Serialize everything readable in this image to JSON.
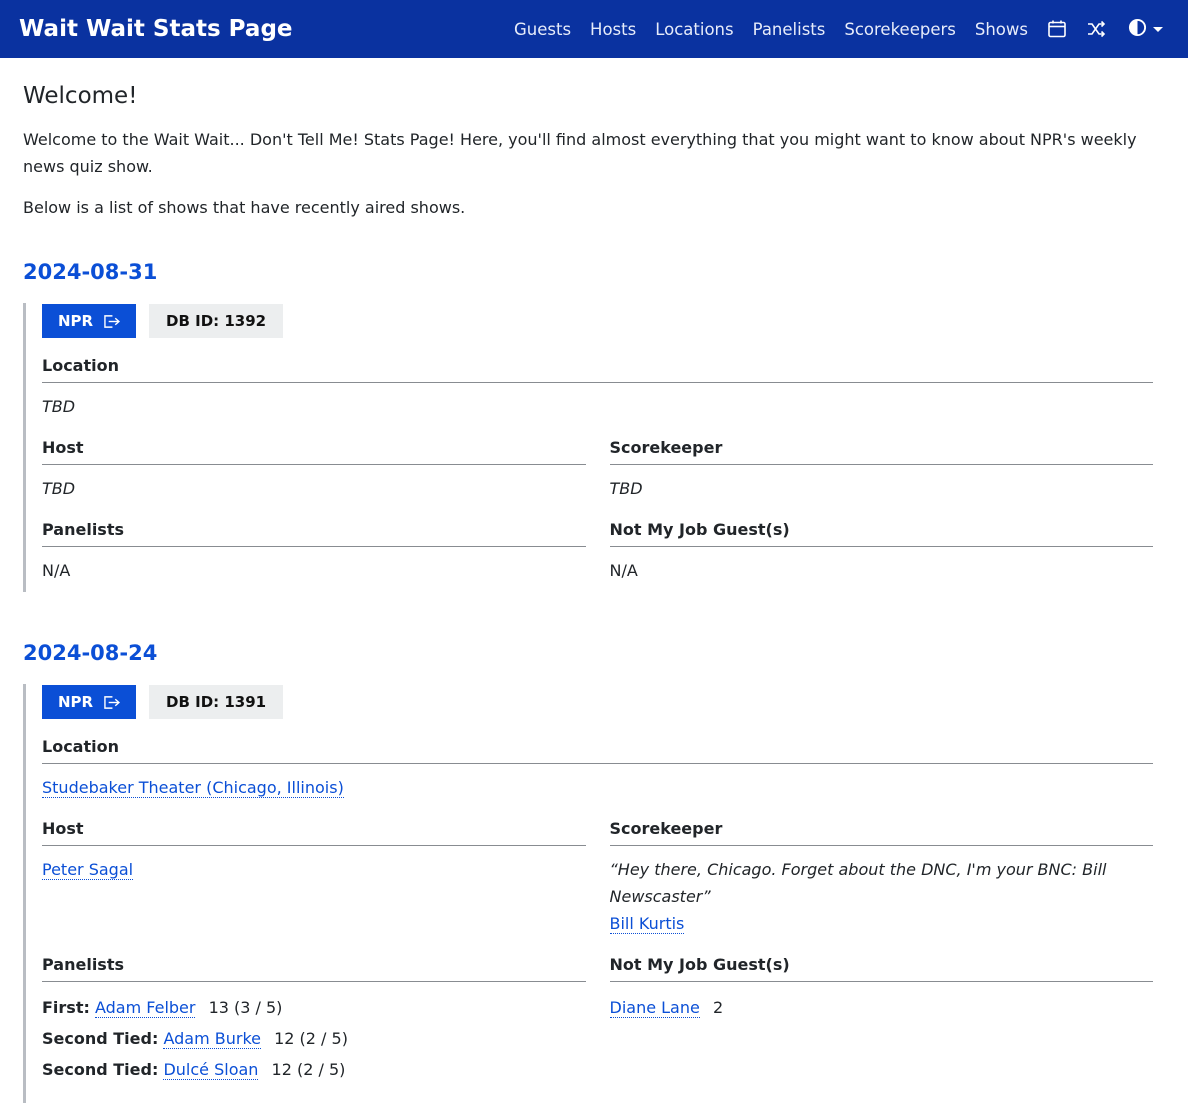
{
  "navbar": {
    "brand": "Wait Wait Stats Page",
    "links": [
      "Guests",
      "Hosts",
      "Locations",
      "Panelists",
      "Scorekeepers",
      "Shows"
    ],
    "icons": [
      "calendar-icon",
      "shuffle-icon",
      "theme-contrast-icon"
    ]
  },
  "welcome": {
    "title": "Welcome!",
    "intro": "Welcome to the Wait Wait... Don't Tell Me! Stats Page! Here, you'll find almost everything that you might want to know about NPR's weekly news quiz show.",
    "recent": "Below is a list of shows that have recently aired shows."
  },
  "labels": {
    "location": "Location",
    "host": "Host",
    "scorekeeper": "Scorekeeper",
    "panelists": "Panelists",
    "guests": "Not My Job Guest(s)",
    "npr": "NPR"
  },
  "shows": [
    {
      "date": "2024-08-31",
      "db_id": "DB ID: 1392",
      "location": "TBD",
      "host": "TBD",
      "scorekeeper": "TBD",
      "panelists": "N/A",
      "guests": "N/A"
    },
    {
      "date": "2024-08-24",
      "db_id": "DB ID: 1391",
      "location": "Studebaker Theater (Chicago, Illinois)",
      "host": "Peter Sagal",
      "scorekeeper_intro": "“Hey there, Chicago. Forget about the DNC, I'm your BNC: Bill Newscaster”",
      "scorekeeper": "Bill Kurtis",
      "panelists": [
        {
          "rank": "First:",
          "name": "Adam Felber",
          "score": "13 (3 / 5)"
        },
        {
          "rank": "Second Tied:",
          "name": "Adam Burke",
          "score": "12 (2 / 5)"
        },
        {
          "rank": "Second Tied:",
          "name": "Dulcé Sloan",
          "score": "12 (2 / 5)"
        }
      ],
      "guests": [
        {
          "name": "Diane Lane",
          "score": "2"
        }
      ]
    }
  ],
  "colors": {
    "navbar": "#0a32a0",
    "link": "#0b4fd6",
    "button": "#0b4fd6",
    "badge_bg": "#eceeef"
  }
}
